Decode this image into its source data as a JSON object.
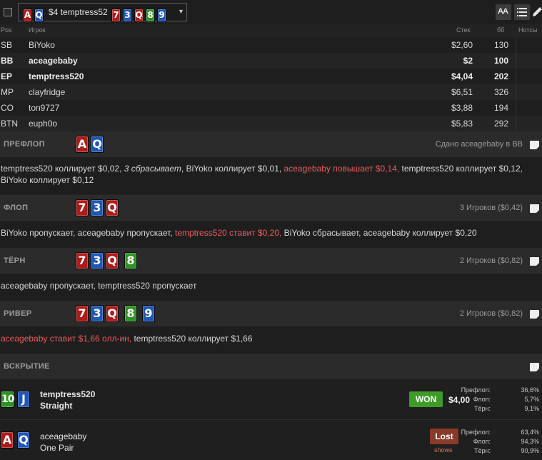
{
  "colors": {
    "red_card": "#b21a1a",
    "blue_card": "#1f56b8",
    "green_card": "#2d9322",
    "highlight": "#ec5c5c",
    "won": "#3e9b28",
    "lost": "#8a3a2a"
  },
  "header": {
    "hero_cards": [
      {
        "rank": "A",
        "color": "red"
      },
      {
        "rank": "Q",
        "color": "blue"
      }
    ],
    "hand_label": "$4 temptress52",
    "board_cards": [
      {
        "rank": "7",
        "color": "red"
      },
      {
        "rank": "3",
        "color": "blue"
      },
      {
        "rank": "Q",
        "color": "red"
      },
      {
        "rank": "8",
        "color": "green"
      },
      {
        "rank": "9",
        "color": "blue"
      }
    ],
    "font_button_label": "AA",
    "icons": [
      "checkbox",
      "chevron-down-icon",
      "font-size-icon",
      "list-icon",
      "pencil-icon"
    ]
  },
  "table": {
    "columns": {
      "pos": "Pos",
      "player": "Игрок",
      "stack": "Стек",
      "bb": "бб",
      "notes": "Нотсы"
    },
    "rows": [
      {
        "pos": "SB",
        "name": "BiYoko",
        "stack": "$2,60",
        "bb": "130",
        "bold": false
      },
      {
        "pos": "BB",
        "name": "aceagebaby",
        "stack": "$2",
        "bb": "100",
        "bold": true
      },
      {
        "pos": "EP",
        "name": "temptress520",
        "stack": "$4,04",
        "bb": "202",
        "bold": true
      },
      {
        "pos": "MP",
        "name": "clayfridge",
        "stack": "$6,51",
        "bb": "326",
        "bold": false
      },
      {
        "pos": "CO",
        "name": "ton9727",
        "stack": "$3,88",
        "bb": "194",
        "bold": false
      },
      {
        "pos": "BTN",
        "name": "euph0o",
        "stack": "$5,83",
        "bb": "292",
        "bold": false
      }
    ]
  },
  "streets": {
    "preflop": {
      "title": "ПРЕФЛОП",
      "info": "Сдано aceagebaby в BB",
      "cards": [
        {
          "rank": "A",
          "color": "red"
        },
        {
          "rank": "Q",
          "color": "blue"
        }
      ],
      "actions": [
        {
          "text": "temptress520 коллирует $0,02, ",
          "style": ""
        },
        {
          "text": "3 сбрасывает",
          "style": "it"
        },
        {
          "text": ", BiYoko коллирует $0,01, ",
          "style": ""
        },
        {
          "text": "aceagebaby повышает $0,14,",
          "style": "hl"
        },
        {
          "text": " temptress520 коллирует $0,12, BiYoko коллирует $0,12",
          "style": ""
        }
      ]
    },
    "flop": {
      "title": "ФЛОП",
      "info": "3 Игроков ($0,42)",
      "cards": [
        {
          "rank": "7",
          "color": "red"
        },
        {
          "rank": "3",
          "color": "blue"
        },
        {
          "rank": "Q",
          "color": "red"
        }
      ],
      "actions": [
        {
          "text": "BiYoko пропускает, aceagebaby пропускает, ",
          "style": ""
        },
        {
          "text": "temptress520 ставит $0,20,",
          "style": "hl"
        },
        {
          "text": " BiYoko сбрасывает, aceagebaby коллирует $0,20",
          "style": ""
        }
      ]
    },
    "turn": {
      "title": "ТЁРН",
      "info": "2 Игроков ($0,82)",
      "cards": [
        {
          "rank": "7",
          "color": "red"
        },
        {
          "rank": "3",
          "color": "blue"
        },
        {
          "rank": "Q",
          "color": "red"
        },
        {
          "rank": "8",
          "color": "green"
        }
      ],
      "actions": [
        {
          "text": "aceagebaby пропускает, temptress520 пропускает",
          "style": ""
        }
      ]
    },
    "river": {
      "title": "РИВЕР",
      "info": "2 Игроков ($0,82)",
      "cards": [
        {
          "rank": "7",
          "color": "red"
        },
        {
          "rank": "3",
          "color": "blue"
        },
        {
          "rank": "Q",
          "color": "red"
        },
        {
          "rank": "8",
          "color": "green"
        },
        {
          "rank": "9",
          "color": "blue"
        }
      ],
      "actions": [
        {
          "text": "aceagebaby ставит $1,66 олл-ин,",
          "style": "hl"
        },
        {
          "text": " temptress520 коллирует $1,66",
          "style": ""
        }
      ]
    }
  },
  "showdown": {
    "title": "ВСКРЫТИЕ",
    "players": [
      {
        "name": "temptress520",
        "hand": "Straight",
        "cards": [
          {
            "rank": "10",
            "color": "green"
          },
          {
            "rank": "J",
            "color": "blue"
          }
        ],
        "result": "WON",
        "amount": "$4,00",
        "equity": [
          {
            "label": "Префлоп:",
            "value": "36,6%"
          },
          {
            "label": "Флоп:",
            "value": "5,7%"
          },
          {
            "label": "Тёрн:",
            "value": "9,1%"
          }
        ]
      },
      {
        "name": "aceagebaby",
        "hand": "One Pair",
        "cards": [
          {
            "rank": "A",
            "color": "red"
          },
          {
            "rank": "Q",
            "color": "blue"
          }
        ],
        "result": "Lost",
        "shows": "shows",
        "equity": [
          {
            "label": "Префлоп:",
            "value": "63,4%"
          },
          {
            "label": "Флоп:",
            "value": "94,3%"
          },
          {
            "label": "Тёрн:",
            "value": "90,9%"
          }
        ]
      }
    ]
  }
}
